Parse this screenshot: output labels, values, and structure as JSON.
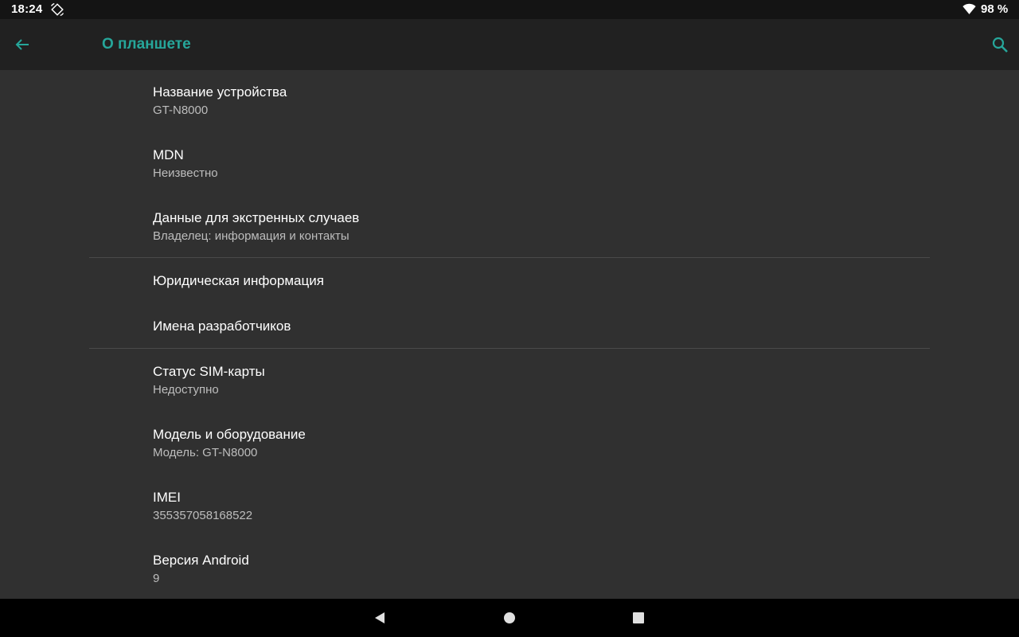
{
  "status_bar": {
    "time": "18:24",
    "battery": "98 %",
    "icons": [
      "screen-rotation-icon",
      "wifi-icon"
    ]
  },
  "app_bar": {
    "title": "О планшете",
    "back_icon": "arrow-back-icon",
    "search_icon": "search-icon",
    "accent_color": "#26a69a"
  },
  "preferences": {
    "device_name": {
      "title": "Название устройства",
      "summary": "GT-N8000"
    },
    "mdn": {
      "title": "MDN",
      "summary": "Неизвестно"
    },
    "emergency": {
      "title": "Данные для экстренных случаев",
      "summary": "Владелец: информация и контакты"
    },
    "legal": {
      "title": "Юридическая информация"
    },
    "contributors": {
      "title": "Имена разработчиков"
    },
    "sim_status": {
      "title": "Статус SIM-карты",
      "summary": "Недоступно"
    },
    "model": {
      "title": "Модель и оборудование",
      "summary": "Модель: GT-N8000"
    },
    "imei": {
      "title": "IMEI",
      "summary": "355357058168522"
    },
    "android_version": {
      "title": "Версия Android",
      "summary": "9"
    }
  },
  "nav_bar": {
    "buttons": [
      "back-triangle-icon",
      "home-circle-icon",
      "recents-square-icon"
    ]
  }
}
